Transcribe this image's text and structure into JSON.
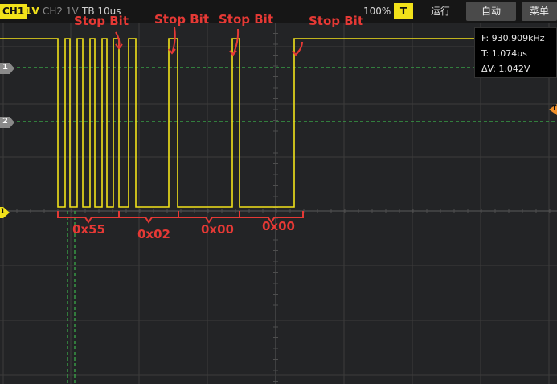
{
  "toolbar": {
    "ch1_label": "CH1",
    "ch1_volt": "1V",
    "ch2_label": "CH2  1V",
    "timebase": "TB 10us",
    "zoom": "100%",
    "trigger": "T",
    "run": "运行",
    "auto_button": "自动",
    "menu_button": "菜单"
  },
  "measurements": {
    "frequency": "F: 930.909kHz",
    "period": "T: 1.074us",
    "delta_v": "ΔV: 1.042V"
  },
  "markers": {
    "cursor1": "1",
    "cursor2": "2",
    "ch1_ground": "1",
    "trigger_level": "T"
  },
  "annotations": {
    "stop_bit_1": "Stop Bit",
    "stop_bit_2": "Stop Bit",
    "stop_bit_3": "Stop Bit",
    "stop_bit_4": "Stop Bit",
    "byte_1": "0x55",
    "byte_2": "0x02",
    "byte_3": "0x00",
    "byte_4": "0x00"
  },
  "colors": {
    "ch1_trace": "#f2e21a",
    "cursor_line": "#3cb44b",
    "annotation": "#e53935",
    "trigger_marker": "#f0902a"
  }
}
